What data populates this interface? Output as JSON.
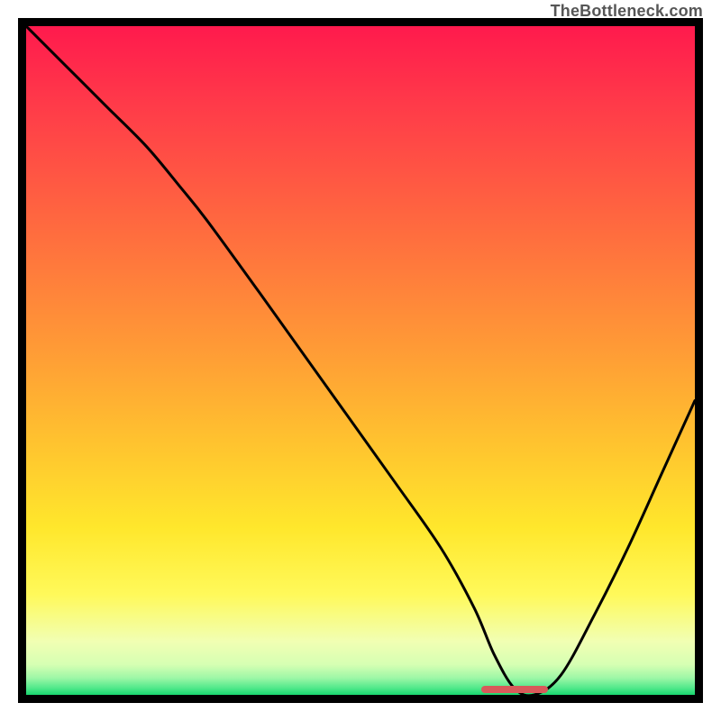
{
  "watermark": "TheBottleneck.com",
  "chart_data": {
    "type": "line",
    "title": "",
    "xlabel": "",
    "ylabel": "",
    "xlim": [
      0,
      100
    ],
    "ylim": [
      0,
      100
    ],
    "gradient_stops": [
      {
        "offset": 0,
        "color": "#ff1a4d"
      },
      {
        "offset": 0.12,
        "color": "#ff3b49"
      },
      {
        "offset": 0.3,
        "color": "#ff6a3f"
      },
      {
        "offset": 0.48,
        "color": "#ff9a36"
      },
      {
        "offset": 0.62,
        "color": "#ffc22f"
      },
      {
        "offset": 0.75,
        "color": "#ffe72c"
      },
      {
        "offset": 0.85,
        "color": "#fff95a"
      },
      {
        "offset": 0.92,
        "color": "#f1ffb3"
      },
      {
        "offset": 0.955,
        "color": "#d6ffb3"
      },
      {
        "offset": 0.975,
        "color": "#9cf7a6"
      },
      {
        "offset": 0.99,
        "color": "#4fe88a"
      },
      {
        "offset": 1.0,
        "color": "#18d66e"
      }
    ],
    "series": [
      {
        "name": "bottleneck-curve",
        "x": [
          0,
          6,
          12,
          18,
          23,
          27,
          35,
          45,
          55,
          62,
          67,
          70,
          73,
          76,
          80,
          85,
          90,
          95,
          100
        ],
        "y": [
          100,
          94,
          88,
          82,
          76,
          71,
          60,
          46,
          32,
          22,
          13,
          6,
          1,
          0,
          3,
          12,
          22,
          33,
          44
        ]
      }
    ],
    "marker": {
      "name": "optimal-range",
      "x_start": 68,
      "x_end": 78,
      "y": 0,
      "color": "#d85a5a"
    }
  }
}
